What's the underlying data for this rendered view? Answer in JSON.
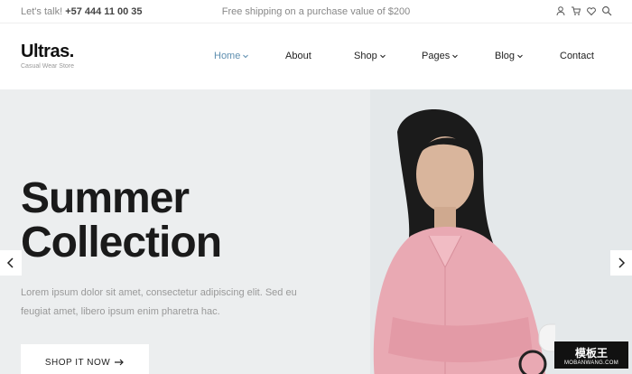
{
  "topbar": {
    "talk_label": "Let's talk!",
    "phone": "+57 444 11 00 35",
    "shipping": "Free shipping on a purchase value of $200",
    "icons": [
      "user-icon",
      "cart-icon",
      "heart-icon",
      "search-icon"
    ]
  },
  "brand": {
    "name": "Ultras.",
    "tagline": "Casual Wear Store"
  },
  "nav": {
    "items": [
      {
        "label": "Home",
        "active": true,
        "dropdown": true
      },
      {
        "label": "About",
        "active": false,
        "dropdown": false
      },
      {
        "label": "Shop",
        "active": false,
        "dropdown": true
      },
      {
        "label": "Pages",
        "active": false,
        "dropdown": true
      },
      {
        "label": "Blog",
        "active": false,
        "dropdown": true
      },
      {
        "label": "Contact",
        "active": false,
        "dropdown": false
      }
    ]
  },
  "hero": {
    "title_line1": "Summer",
    "title_line2": "Collection",
    "lead": "Lorem ipsum dolor sit amet, consectetur adipiscing elit. Sed eu feugiat amet, libero ipsum enim pharetra hac.",
    "cta_label": "SHOP IT NOW"
  },
  "watermark": {
    "line1": "模板王",
    "line2": "MOBANWANG.COM"
  },
  "colors": {
    "accent": "#5f8fb0",
    "hero_bg": "#eceeef",
    "shirt": "#e9a9b3"
  }
}
